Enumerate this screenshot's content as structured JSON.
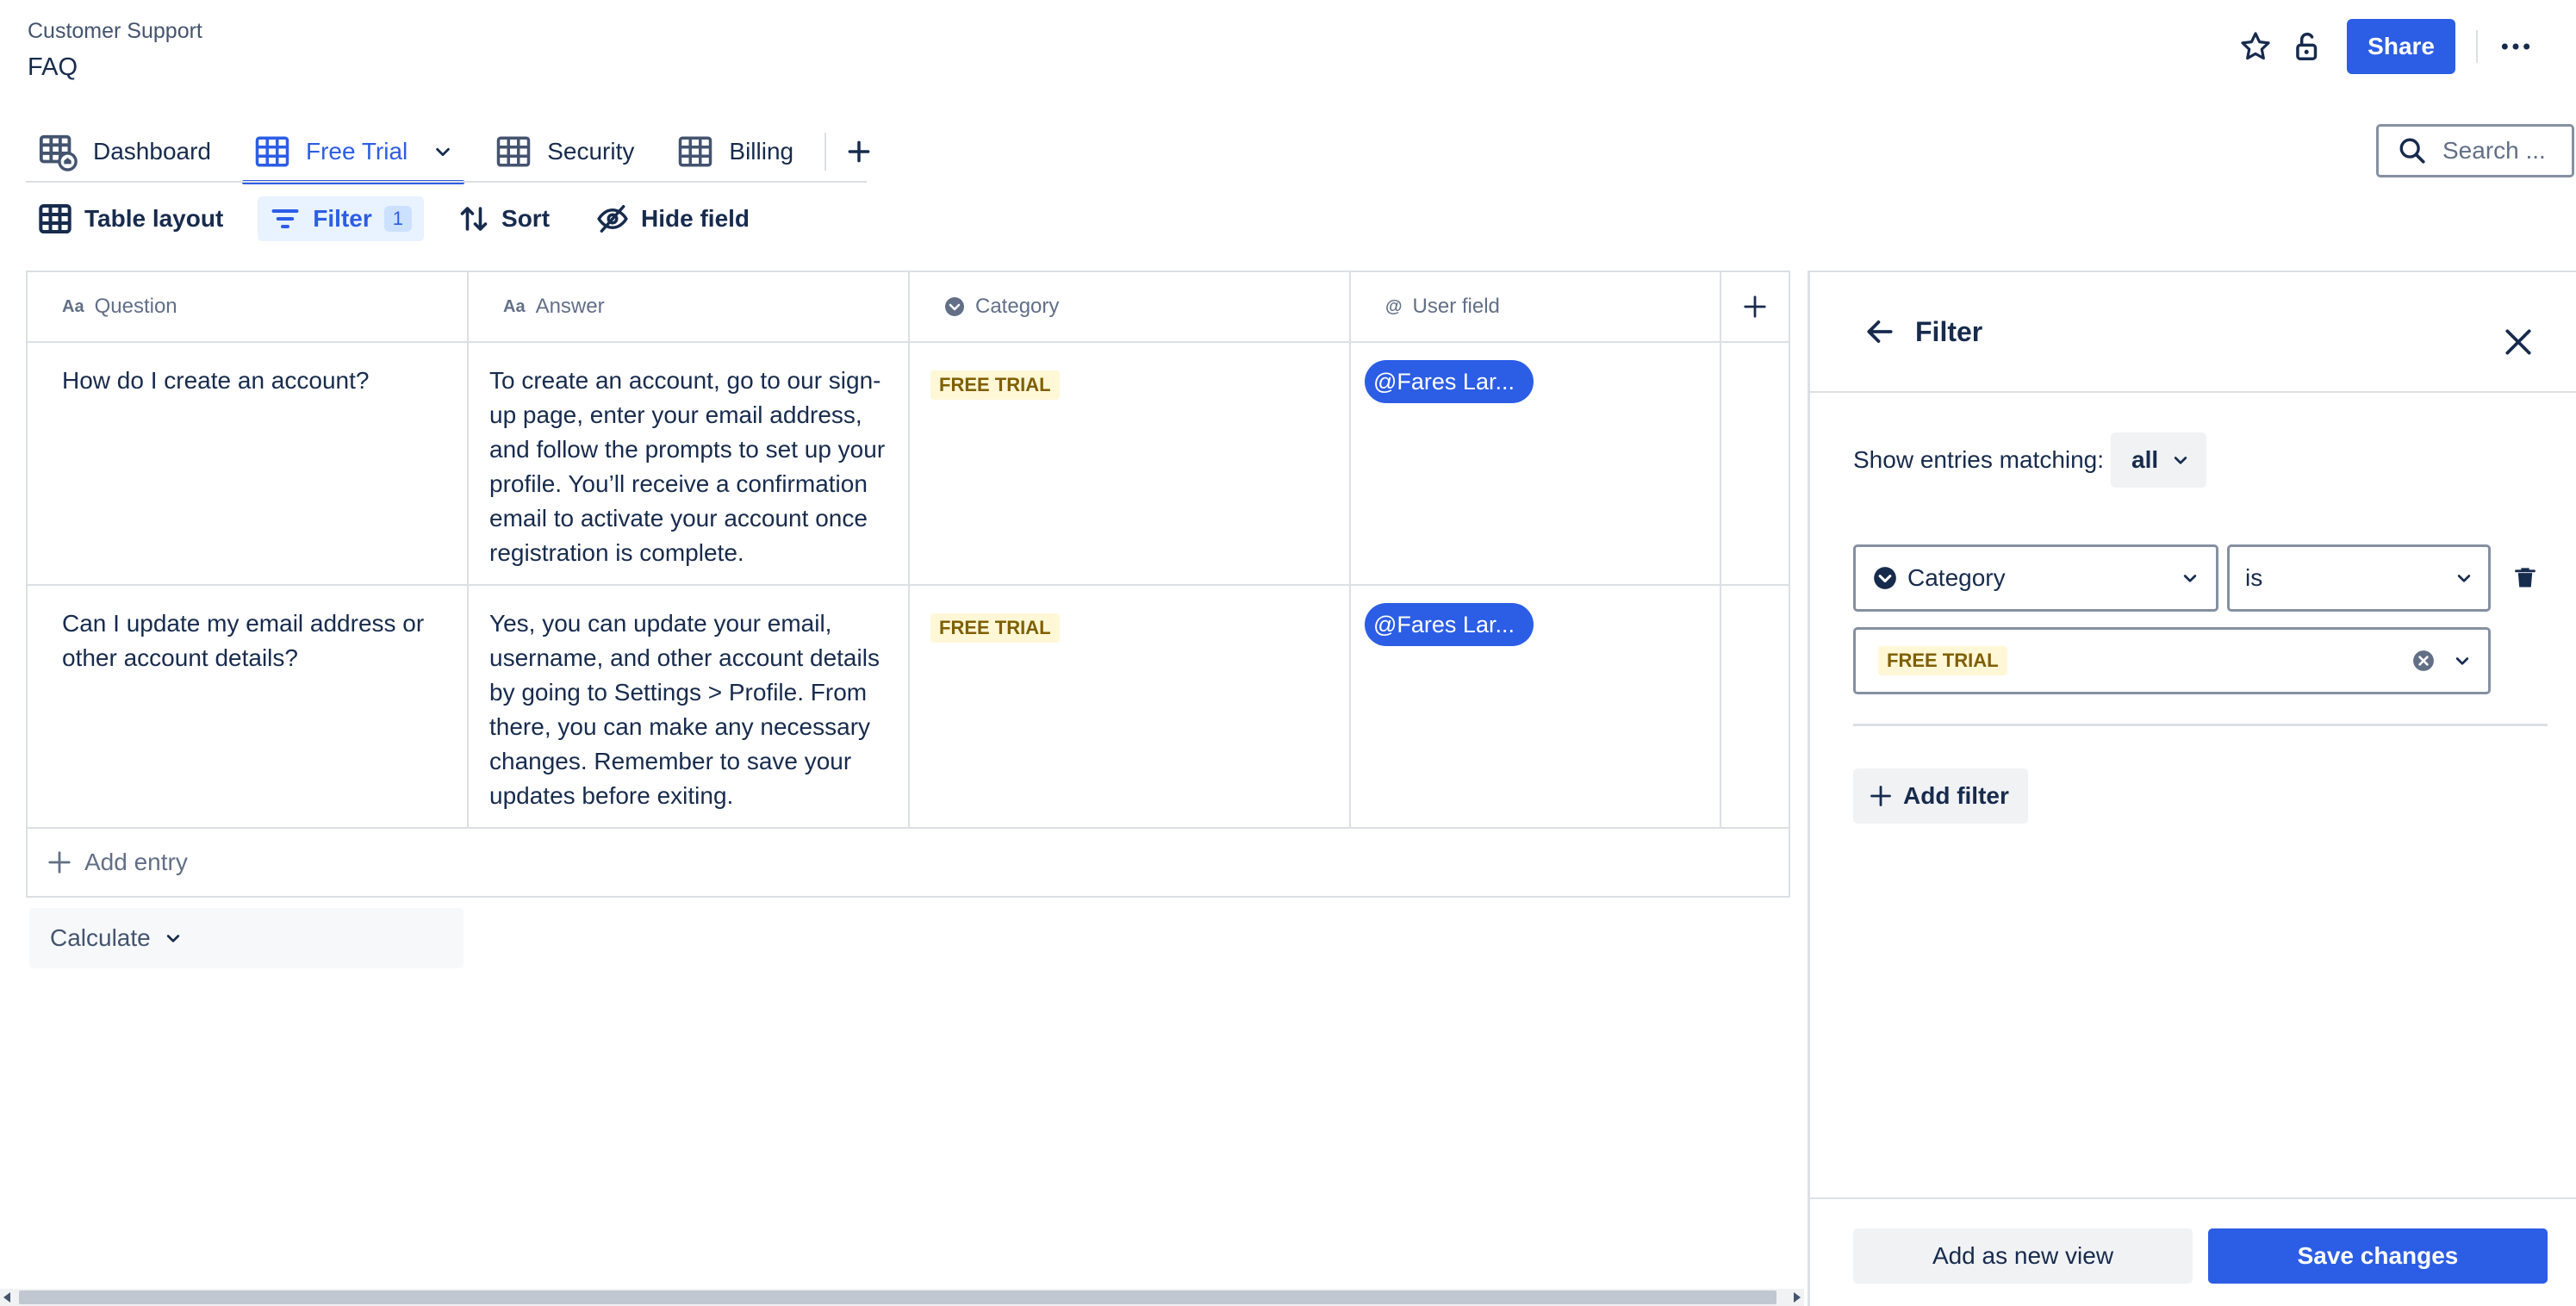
{
  "header": {
    "breadcrumb": "Customer Support",
    "title": "FAQ",
    "share_label": "Share",
    "icons": [
      "star-icon",
      "unlock-icon",
      "more-icon"
    ]
  },
  "tabs": [
    {
      "label": "Dashboard",
      "icon": "dashboard-table-icon",
      "active": false
    },
    {
      "label": "Free Trial",
      "icon": "table-icon",
      "active": true
    },
    {
      "label": "Security",
      "icon": "table-icon",
      "active": false
    },
    {
      "label": "Billing",
      "icon": "table-icon",
      "active": false
    }
  ],
  "search": {
    "placeholder": "Search ..."
  },
  "toolbar": {
    "table_layout": "Table layout",
    "filter": "Filter",
    "filter_count": "1",
    "sort": "Sort",
    "hide_field": "Hide field"
  },
  "table": {
    "columns": [
      {
        "label": "Question",
        "icon": "text-field-icon"
      },
      {
        "label": "Answer",
        "icon": "text-field-icon"
      },
      {
        "label": "Category",
        "icon": "category-icon"
      },
      {
        "label": "User field",
        "icon": "mention-icon"
      }
    ],
    "rows": [
      {
        "question": "How do I create an account?",
        "answer": "To create an account, go to our sign-up page, enter your email address, and follow the prompts to set up your profile. You’ll receive a confirmation email to activate your account once registration is complete.",
        "category": "FREE TRIAL",
        "user": "@Fares Lar..."
      },
      {
        "question": "Can I update my email address or other account details?",
        "answer": "Yes, you can update your email, username, and other account details by going to Settings > Profile. From there, you can make any necessary changes. Remember to save your updates before exiting.",
        "category": "FREE TRIAL",
        "user": "@Fares Lar..."
      }
    ],
    "add_entry": "Add entry"
  },
  "calculate_label": "Calculate",
  "filter_panel": {
    "title": "Filter",
    "match_label": "Show entries matching:",
    "match_value": "all",
    "field": "Category",
    "operator": "is",
    "value_tag": "FREE TRIAL",
    "add_filter": "Add filter",
    "add_view": "Add as new view",
    "save": "Save changes"
  },
  "colors": {
    "accent": "#2c5de5",
    "tag_bg": "#fff7d6",
    "tag_text": "#7f5f01",
    "border": "#dcdfe4"
  }
}
